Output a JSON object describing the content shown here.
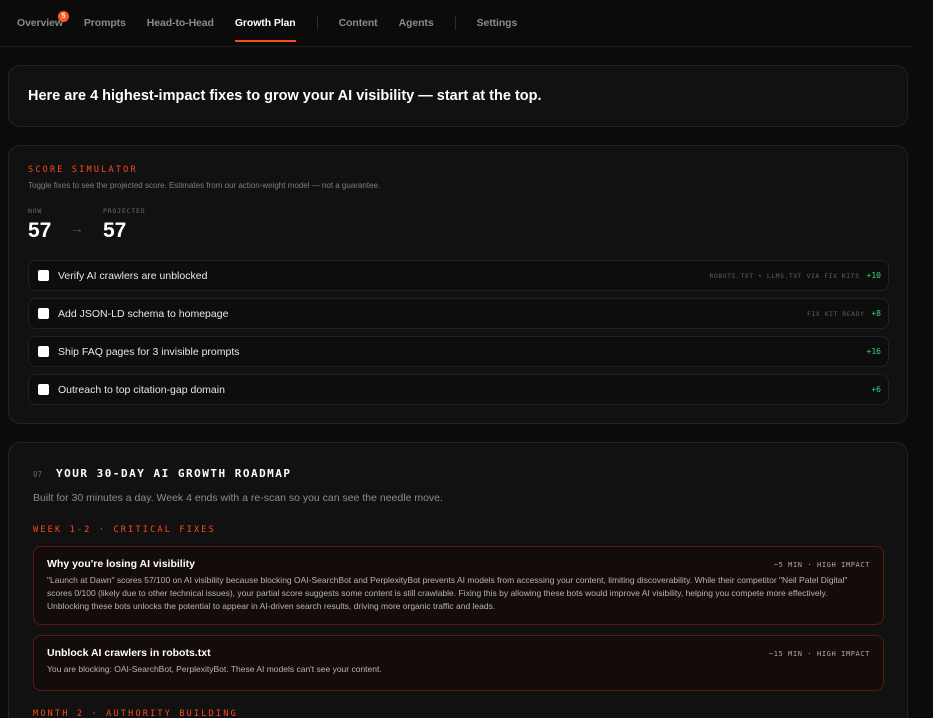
{
  "nav": {
    "tabs": [
      {
        "label": "Overview",
        "badge": "5"
      },
      {
        "label": "Prompts"
      },
      {
        "label": "Head-to-Head"
      },
      {
        "label": "Growth Plan",
        "active": true
      },
      {
        "label": "Content"
      },
      {
        "label": "Agents"
      },
      {
        "label": "Settings"
      }
    ]
  },
  "hero": {
    "title": "Here are 4 highest-impact fixes to grow your AI visibility — start at the top."
  },
  "simulator": {
    "eyebrow": "SCORE SIMULATOR",
    "subtitle": "Toggle fixes to see the projected score. Estimates from our action-weight model — not a guarantee.",
    "now_label": "NOW",
    "now_value": "57",
    "projected_label": "PROJECTED",
    "projected_value": "57",
    "arrow": "→",
    "fixes": [
      {
        "label": "Verify AI crawlers are unblocked",
        "tag": "ROBOTS.TXT + LLMS.TXT VIA FIX KITS",
        "points": "+10",
        "checked": false
      },
      {
        "label": "Add JSON-LD schema to homepage",
        "tag": "FIX KIT READY",
        "points": "+8",
        "checked": false
      },
      {
        "label": "Ship FAQ pages for 3 invisible prompts",
        "tag": "",
        "points": "+16",
        "checked": false
      },
      {
        "label": "Outreach to top citation-gap domain",
        "tag": "",
        "points": "+6",
        "checked": false
      }
    ]
  },
  "roadmap": {
    "number": "07",
    "title": "YOUR 30-DAY AI GROWTH ROADMAP",
    "subtitle": "Built for 30 minutes a day. Week 4 ends with a re-scan so you can see the needle move.",
    "section1": "WEEK 1-2 · CRITICAL FIXES",
    "tasks": [
      {
        "title": "Why you're losing AI visibility",
        "meta": "~5 MIN · HIGH IMPACT",
        "body": "\"Launch at Dawn\" scores 57/100 on AI visibility because blocking OAI-SearchBot and PerplexityBot prevents AI models from accessing your content, limiting discoverability. While their competitor \"Neil Patel Digital\" scores 0/100 (likely due to other technical issues), your partial score suggests some content is still crawlable. Fixing this by allowing these bots would improve AI visibility, helping you compete more effectively. Unblocking these bots unlocks the potential to appear in AI-driven search results, driving more organic traffic and leads."
      },
      {
        "title": "Unblock AI crawlers in robots.txt",
        "meta": "~15 MIN · HIGH IMPACT",
        "body": "You are blocking: OAI-SearchBot, PerplexityBot. These AI models can't see your content."
      }
    ],
    "section2": "MONTH 2 · AUTHORITY BUILDING"
  },
  "colors": {
    "accent": "#ff4a1c",
    "positive": "#3fd17a",
    "background": "#0b0b0b"
  }
}
